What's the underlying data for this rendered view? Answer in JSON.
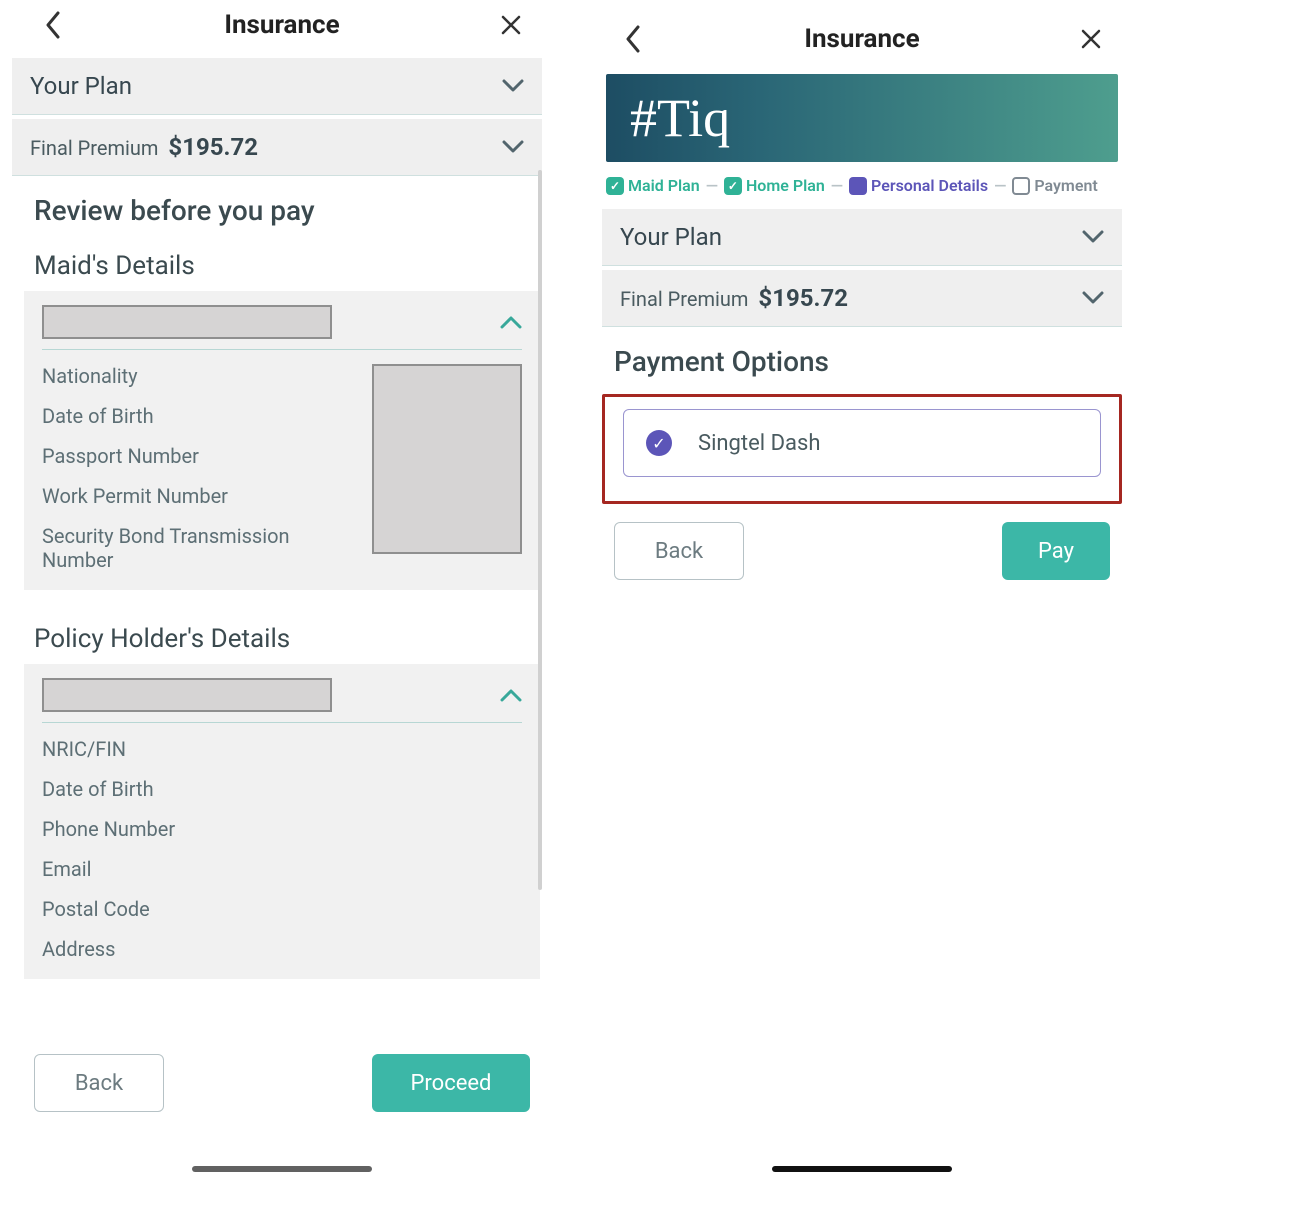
{
  "left": {
    "header": {
      "title": "Insurance"
    },
    "your_plan_label": "Your Plan",
    "final_premium_label": "Final Premium",
    "final_premium_amount": "$195.72",
    "review_heading": "Review before you pay",
    "maid": {
      "heading": "Maid's Details",
      "fields": [
        "Nationality",
        "Date of Birth",
        "Passport Number",
        "Work Permit Number",
        "Security Bond Transmission Number"
      ]
    },
    "holder": {
      "heading": "Policy Holder's Details",
      "fields": [
        "NRIC/FIN",
        "Date of Birth",
        "Phone Number",
        "Email",
        "Postal Code",
        "Address"
      ]
    },
    "back_label": "Back",
    "proceed_label": "Proceed"
  },
  "right": {
    "header": {
      "title": "Insurance"
    },
    "brand": "#Tiq",
    "steps": {
      "maid": "Maid Plan",
      "home": "Home Plan",
      "personal": "Personal Details",
      "payment": "Payment"
    },
    "your_plan_label": "Your Plan",
    "final_premium_label": "Final Premium",
    "final_premium_amount": "$195.72",
    "payment_heading": "Payment Options",
    "payment_option": "Singtel Dash",
    "back_label": "Back",
    "pay_label": "Pay"
  }
}
